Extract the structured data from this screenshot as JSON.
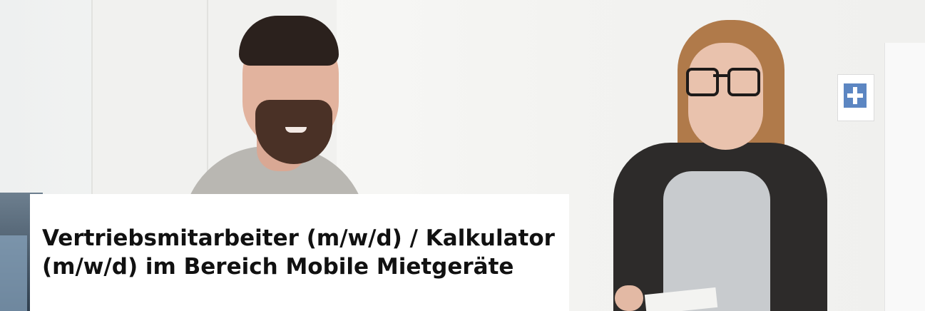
{
  "hero": {
    "image_description_icon": "people-photo-icon",
    "title": "Vertriebsmitarbeiter (m/w/d) / Kalkulator (m/w/d) im Bereich Mobile Mietgeräte"
  },
  "colors": {
    "card_background": "#ffffff",
    "title_color": "#111111"
  }
}
